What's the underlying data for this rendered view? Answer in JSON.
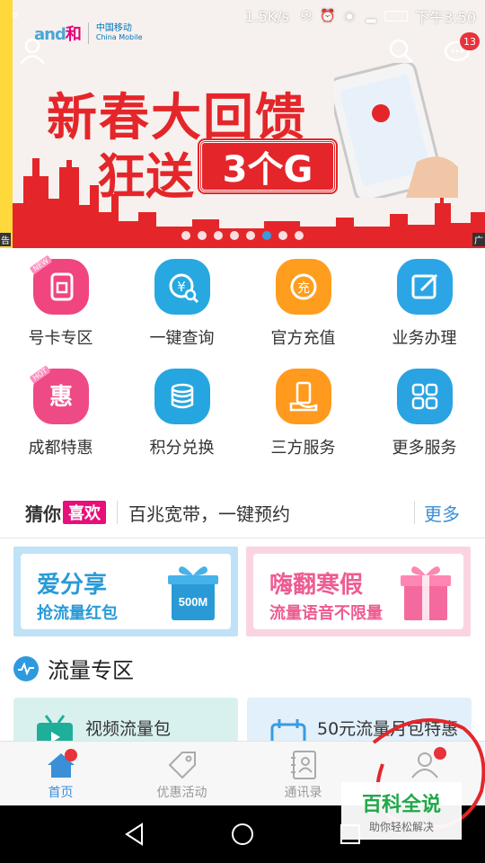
{
  "status_bar": {
    "speed": "1.5K/s",
    "time": "下午3:50",
    "icons": [
      "headset-icon",
      "alarm-icon",
      "eye-icon",
      "signal-icon",
      "battery-icon"
    ]
  },
  "header": {
    "brand": "和",
    "brand_prefix": "and",
    "carrier_cn": "中国移动",
    "carrier_en": "China Mobile",
    "message_badge": "13"
  },
  "banner": {
    "title_line1": "新春大回馈",
    "title_line2": "狂送",
    "highlight": "3个G",
    "left_tag": "告",
    "corner_tag": "广",
    "slide_count": 8,
    "active_slide": 6
  },
  "services": [
    {
      "label": "号卡专区",
      "icon": "sim-card-icon",
      "color": "#f0457f",
      "ribbon": "NEW"
    },
    {
      "label": "一键查询",
      "icon": "yuan-search-icon",
      "color": "#27a8e0",
      "ribbon": ""
    },
    {
      "label": "官方充值",
      "icon": "recharge-icon",
      "color": "#ff9d1e",
      "ribbon": ""
    },
    {
      "label": "业务办理",
      "icon": "edit-icon",
      "color": "#2ca5e6",
      "ribbon": ""
    },
    {
      "label": "成都特惠",
      "icon": "discount-icon",
      "color": "#ee4a86",
      "ribbon": "HOT"
    },
    {
      "label": "积分兑换",
      "icon": "coins-icon",
      "color": "#26a6e0",
      "ribbon": ""
    },
    {
      "label": "三方服务",
      "icon": "hand-phone-icon",
      "color": "#ff9a1f",
      "ribbon": ""
    },
    {
      "label": "更多服务",
      "icon": "grid-icon",
      "color": "#2aa3e3",
      "ribbon": ""
    }
  ],
  "guess": {
    "prefix": "猜你",
    "tag": "喜欢",
    "text": "百兆宽带，一键预约",
    "more": "更多"
  },
  "promos": [
    {
      "title": "爱分享",
      "subtitle": "抢流量红包",
      "gift_text": "500M"
    },
    {
      "title": "嗨翻寒假",
      "subtitle": "流量语音不限量"
    }
  ],
  "section": {
    "title": "流量专区"
  },
  "flow_cards": [
    {
      "label": "视频流量包"
    },
    {
      "label": "50元流量月包特惠"
    }
  ],
  "bottom_nav": [
    {
      "label": "首页",
      "active": true,
      "dot": true
    },
    {
      "label": "优惠活动",
      "active": false,
      "dot": false
    },
    {
      "label": "通讯录",
      "active": false,
      "dot": false
    },
    {
      "label": "",
      "active": false,
      "dot": true
    }
  ],
  "watermark": {
    "title": "百科全说",
    "subtitle": "助你轻松解决"
  },
  "colors": {
    "accent": "#3a8fd6",
    "banner_red": "#e4262a",
    "badge_red": "#e8323c",
    "guess_pink": "#e6107a"
  }
}
